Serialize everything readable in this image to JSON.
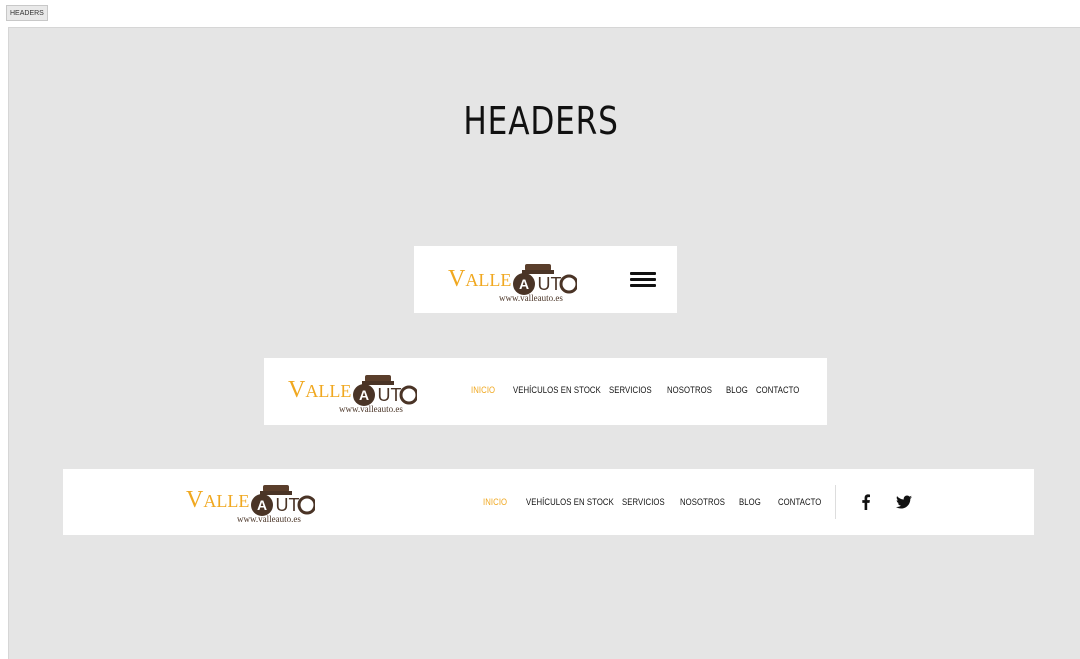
{
  "tab": {
    "label": "HEADERS"
  },
  "page": {
    "title": "HEADERS"
  },
  "logo": {
    "word_v": "V",
    "word_alle": "ALLE",
    "auto_label": "AUTO",
    "url": "www.valleauto.es"
  },
  "nav": {
    "items": [
      "INICIO",
      "VEHÍCULOS EN STOCK",
      "SERVICIOS",
      "NOSOTROS",
      "BLOG",
      "CONTACTO"
    ],
    "active_index": 0
  },
  "social": [
    "facebook-icon",
    "twitter-icon"
  ],
  "colors": {
    "accent": "#f0a820",
    "logo_brown": "#4a3426",
    "canvas_bg": "#e5e5e5",
    "card_bg": "#ffffff",
    "text": "#111111"
  }
}
